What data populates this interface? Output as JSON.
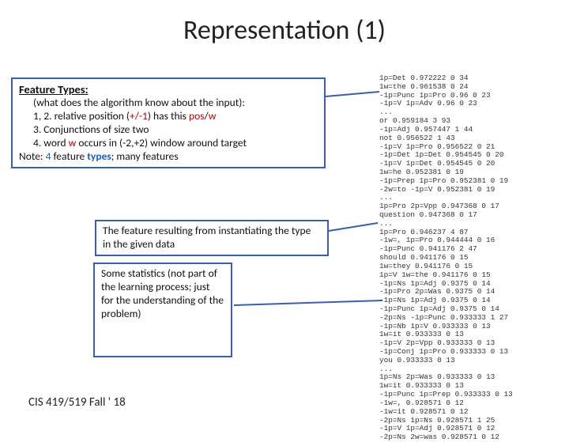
{
  "title": "Representation (1)",
  "footer": "CIS 419/519 Fall ' 18",
  "box1": {
    "hdr": "Feature Types:",
    "l1": "(what does the algorithm know about the input):",
    "l2a": "1, 2. relative position (",
    "l2b": "+/-1",
    "l2c": ") has this ",
    "l2d": "pos",
    "l2e": "/",
    "l2f": "w",
    "l3": "3. Conjunctions of size two",
    "l4a": "4. word ",
    "l4b": "w",
    "l4c": " occurs in (-2,+2) window around target",
    "l5a": "Note: ",
    "l5b": "4",
    "l5c": " feature ",
    "l5d": "types",
    "l5e": "; many features"
  },
  "box2": {
    "text": "The feature resulting from instantiating the type in the given data"
  },
  "box3": {
    "text": "Some statistics (not part of the learning process; just for the understanding of the problem)"
  },
  "records": [
    "1p=Det 0.972222 0 34",
    "1w=the 0.961538 0 24",
    "-1p=Punc 1p=Pro 0.96 0 23",
    "-1p=V 1p=Adv 0.96 0 23",
    "...",
    "or 0.959184 3 93",
    "-1p=Adj 0.957447 1 44",
    "not 0.956522 1 43",
    "-1p=V 1p=Pro 0.956522 0 21",
    "-1p=Det 1p=Det 0.954545 0 20",
    "-1p=V 1p=Det 0.954545 0 20",
    "1w=he 0.952381 0 19",
    "-1p=Prep 1p=Pro 0.952381 0 19",
    "-2w=to -1p=V 0.952381 0 19",
    "...",
    "1p=Pro 2p=Vpp 0.947368 0 17",
    "question 0.947368 0 17",
    "...",
    "1p=Pro 0.946237 4 87",
    "-1w=, 1p=Pro 0.944444 0 16",
    "-1p=Punc 0.941176 2 47",
    "should 0.941176 0 15",
    "1w=they 0.941176 0 15",
    "1p=V 1w=the 0.941176 0 15",
    "-1p=Ns 1p=Adj 0.9375 0 14",
    "-1p=Pro 2p=Was 0.9375 0 14",
    "-1p=Ns 1p=Adj 0.9375 0 14",
    "-1p=Punc 1p=Adj 0.9375 0 14",
    "-2p=Ns -1p=Punc 0.933333 1 27",
    "-1p=Nb 1p=V 0.933333 0 13",
    "1w=it 0.933333 0 13",
    "-1p=V 2p=Vpp 0.933333 0 13",
    "-1p=Conj 1p=Pro 0.933333 0 13",
    "you 0.933333 0 13",
    "...",
    "1p=Ns 2p=Was 0.933333 0 13",
    "1w=it 0.933333 0 13",
    "-1p=Punc 1p=Prep 0.933333 0 13",
    "-1w=, 0.928571 0 12",
    "-1w=it 0.928571 0 12",
    "-2p=Ns 1p=Ns 0.928571 1 25",
    "-1p=V 1p=Adj 0.928571 0 12",
    "-2p=Ns 2w=was 0.928571 0 12"
  ]
}
